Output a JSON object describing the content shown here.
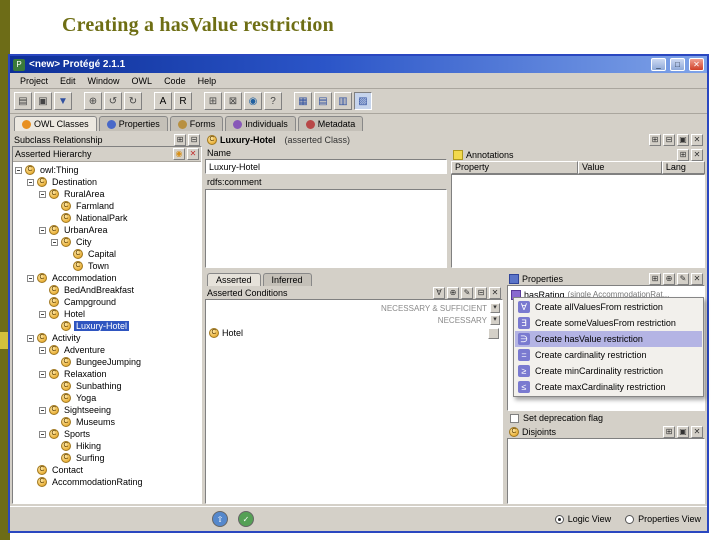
{
  "slide": {
    "title": "Creating a hasValue restriction"
  },
  "window": {
    "title": "<new>  Protégé 2.1.1",
    "controls": {
      "minimize": "_",
      "maximize": "□",
      "close": "✕"
    }
  },
  "menubar": {
    "items": [
      "Project",
      "Edit",
      "Window",
      "OWL",
      "Code",
      "Help"
    ]
  },
  "toolbar": {
    "buttons": [
      {
        "name": "new-project-icon",
        "glyph": "▤"
      },
      {
        "name": "open-project-icon",
        "glyph": "▣"
      },
      {
        "name": "save-project-icon",
        "glyph": "▼",
        "color": "#3050a0"
      },
      {
        "name": "build-ontology-icon",
        "glyph": "⊕",
        "gap": true
      },
      {
        "name": "undo-icon",
        "glyph": "↺"
      },
      {
        "name": "redo-icon",
        "glyph": "↻"
      },
      {
        "name": "annotation-a-icon",
        "glyph": "A",
        "gap": true,
        "color": "#000000"
      },
      {
        "name": "annotation-r-icon",
        "glyph": "R",
        "color": "#000000"
      },
      {
        "name": "archive-icon",
        "glyph": "⊞",
        "gap": true
      },
      {
        "name": "extract-icon",
        "glyph": "⊠"
      },
      {
        "name": "web-reference-icon",
        "glyph": "◉",
        "color": "#2060a0"
      },
      {
        "name": "help-icon",
        "glyph": "?"
      },
      {
        "name": "classes-view-icon",
        "glyph": "▦",
        "gap": true,
        "color": "#3050a0"
      },
      {
        "name": "forms-view-icon",
        "glyph": "▤",
        "color": "#3050a0"
      },
      {
        "name": "individuals-view-icon",
        "glyph": "▥",
        "color": "#3050a0"
      },
      {
        "name": "metadata-view-icon",
        "glyph": "▨",
        "color": "#3050a0",
        "pressed": true
      }
    ]
  },
  "main_tabs": {
    "items": [
      {
        "label": "OWL Classes",
        "color": "#e89020",
        "active": true
      },
      {
        "label": "Properties",
        "color": "#4868c8"
      },
      {
        "label": "Forms",
        "color": "#b89040"
      },
      {
        "label": "Individuals",
        "color": "#8858b8"
      },
      {
        "label": "Metadata",
        "color": "#b84848"
      }
    ]
  },
  "class_browser": {
    "header": "Subclass Relationship",
    "header_buttons": [
      {
        "name": "expand-all-icon",
        "glyph": "⊞"
      },
      {
        "name": "collapse-all-icon",
        "glyph": "⊟"
      }
    ],
    "hierarchy_label": "Asserted Hierarchy",
    "hierarchy_buttons": [
      {
        "name": "create-class-icon",
        "glyph": "◉",
        "color": "#d89018"
      },
      {
        "name": "delete-class-icon",
        "glyph": "✕",
        "color": "#c03030"
      }
    ],
    "tree": [
      {
        "label": "owl:Thing",
        "depth": 0,
        "exp": true
      },
      {
        "label": "Destination",
        "depth": 1,
        "exp": true
      },
      {
        "label": "RuralArea",
        "depth": 2,
        "exp": true
      },
      {
        "label": "Farmland",
        "depth": 3
      },
      {
        "label": "NationalPark",
        "depth": 3
      },
      {
        "label": "UrbanArea",
        "depth": 2,
        "exp": true
      },
      {
        "label": "City",
        "depth": 3,
        "exp": true
      },
      {
        "label": "Capital",
        "depth": 4
      },
      {
        "label": "Town",
        "depth": 4
      },
      {
        "label": "Accommodation",
        "depth": 1,
        "exp": true
      },
      {
        "label": "BedAndBreakfast",
        "depth": 2
      },
      {
        "label": "Campground",
        "depth": 2
      },
      {
        "label": "Hotel",
        "depth": 2,
        "exp": true
      },
      {
        "label": "Luxury-Hotel",
        "depth": 3,
        "selected": true
      },
      {
        "label": "Activity",
        "depth": 1,
        "exp": true
      },
      {
        "label": "Adventure",
        "depth": 2,
        "exp": true
      },
      {
        "label": "BungeeJumping",
        "depth": 3
      },
      {
        "label": "Relaxation",
        "depth": 2,
        "exp": true
      },
      {
        "label": "Sunbathing",
        "depth": 3
      },
      {
        "label": "Yoga",
        "depth": 3
      },
      {
        "label": "Sightseeing",
        "depth": 2,
        "exp": true
      },
      {
        "label": "Museums",
        "depth": 3
      },
      {
        "label": "Sports",
        "depth": 2,
        "exp": true
      },
      {
        "label": "Hiking",
        "depth": 3
      },
      {
        "label": "Surfing",
        "depth": 3
      },
      {
        "label": "Contact",
        "depth": 1
      },
      {
        "label": "AccommodationRating",
        "depth": 1
      }
    ]
  },
  "class_editor": {
    "selected_class": "Luxury-Hotel",
    "class_kind": "(asserted Class)",
    "header_buttons": [
      {
        "name": "expand-form-icon",
        "glyph": "⊞"
      },
      {
        "name": "collapse-form-icon",
        "glyph": "⊟"
      },
      {
        "name": "form-layout-icon",
        "glyph": "▣"
      },
      {
        "name": "close-form-icon",
        "glyph": "✕"
      }
    ],
    "name_label": "Name",
    "name_value": "Luxury-Hotel",
    "comment_label": "rdfs:comment",
    "comment_value": "",
    "view_tabs": [
      {
        "label": "Asserted",
        "active": true
      },
      {
        "label": "Inferred"
      }
    ],
    "conditions": {
      "header": "Asserted Conditions",
      "buttons": [
        {
          "name": "create-restriction-icon",
          "glyph": "∀"
        },
        {
          "name": "add-named-class-icon",
          "glyph": "⊕"
        },
        {
          "name": "edit-expression-icon",
          "glyph": "✎"
        },
        {
          "name": "remove-condition-icon",
          "glyph": "⊟"
        },
        {
          "name": "delete-condition-icon",
          "glyph": "✕"
        }
      ],
      "necessary_sufficient_label": "NECESSARY & SUFFICIENT",
      "necessary_label": "NECESSARY",
      "necessary_classes": [
        "Hotel"
      ]
    }
  },
  "annotations": {
    "header": "Annotations",
    "buttons": [
      {
        "name": "create-annotation-icon",
        "glyph": "⊞"
      },
      {
        "name": "delete-annotation-icon",
        "glyph": "✕"
      }
    ],
    "columns": [
      "Property",
      "Value",
      "Lang"
    ]
  },
  "properties_widget": {
    "header": "Properties",
    "buttons": [
      {
        "name": "create-property-icon",
        "glyph": "⊞"
      },
      {
        "name": "add-property-icon",
        "glyph": "⊕"
      },
      {
        "name": "edit-property-icon",
        "glyph": "✎"
      },
      {
        "name": "remove-property-icon",
        "glyph": "✕"
      }
    ],
    "items": [
      {
        "name": "hasRating",
        "detail": "(single AccommodationRat..."
      }
    ],
    "deprecation_label": "Set deprecation flag"
  },
  "disjoints_widget": {
    "header": "Disjoints",
    "buttons": [
      {
        "name": "add-disjoint-icon",
        "glyph": "⊞"
      },
      {
        "name": "add-sibling-disjoints-icon",
        "glyph": "▣"
      },
      {
        "name": "delete-disjoint-icon",
        "glyph": "✕"
      }
    ]
  },
  "context_menu": {
    "items": [
      {
        "label": "Create allValuesFrom restriction",
        "glyph": "∀"
      },
      {
        "label": "Create someValuesFrom restriction",
        "glyph": "∃"
      },
      {
        "label": "Create hasValue restriction",
        "glyph": "∋",
        "selected": true
      },
      {
        "label": "Create cardinality restriction",
        "glyph": "="
      },
      {
        "label": "Create minCardinality restriction",
        "glyph": "≥"
      },
      {
        "label": "Create maxCardinality restriction",
        "glyph": "≤"
      }
    ]
  },
  "footer": {
    "views": [
      {
        "label": "Logic View",
        "selected": true
      },
      {
        "label": "Properties View"
      }
    ]
  },
  "icons": {
    "class_letter": "C",
    "window_logo": "P",
    "footer_up": "⇧",
    "footer_check": "✓"
  }
}
